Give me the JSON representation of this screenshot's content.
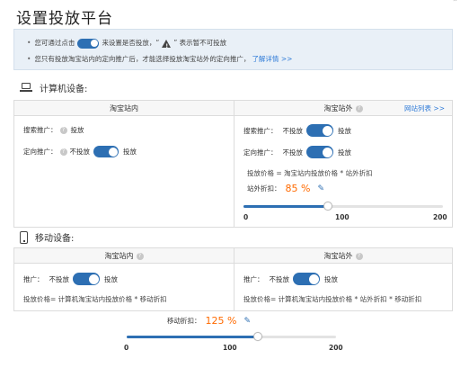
{
  "page": {
    "title": "设置投放平台"
  },
  "info": {
    "line1_a": "您可通过点击",
    "line1_b": "来设置是否投放，“",
    "line1_c": "” 表示暂不可投放",
    "line2_text": "您只有投放淘宝站内的定向推广后，才能选择投放淘宝站外的定向推广，",
    "line2_link": "了解详情 >>"
  },
  "computer": {
    "section_title": "计算机设备:",
    "inside": {
      "header": "淘宝站内",
      "search_label": "搜索推广：",
      "search_on": "投放",
      "target_label": "定向推广：",
      "target_off": "不投放",
      "target_on": "投放"
    },
    "outside": {
      "header": "淘宝站外",
      "site_list_link": "网站列表 >>",
      "search_label": "搜索推广：",
      "search_off": "不投放",
      "search_on": "投放",
      "target_label": "定向推广：",
      "target_off": "不投放",
      "target_on": "投放",
      "formula": "投放价格 = 淘宝站内投放价格 * 站外折扣",
      "discount_label": "站外折扣：",
      "discount_value": "85 %",
      "discount_percent": 85,
      "slider_min": "0",
      "slider_mid": "100",
      "slider_max": "200"
    }
  },
  "mobile": {
    "section_title": "移动设备:",
    "inside": {
      "header": "淘宝站内",
      "promo_label": "推广：",
      "promo_off": "不投放",
      "promo_on": "投放",
      "formula": "投放价格= 计算机淘宝站内投放价格 * 移动折扣"
    },
    "outside": {
      "header": "淘宝站外",
      "promo_label": "推广：",
      "promo_off": "不投放",
      "promo_on": "投放",
      "formula": "投放价格= 计算机淘宝站内投放价格 * 站外折扣 * 移动折扣"
    },
    "discount_label": "移动折扣：",
    "discount_value": "125 %",
    "discount_percent": 125,
    "slider_min": "0",
    "slider_mid": "100",
    "slider_max": "200"
  },
  "colors": {
    "accent": "#2d6fb3",
    "highlight": "#ff6a00",
    "link": "#2f7bd8"
  }
}
